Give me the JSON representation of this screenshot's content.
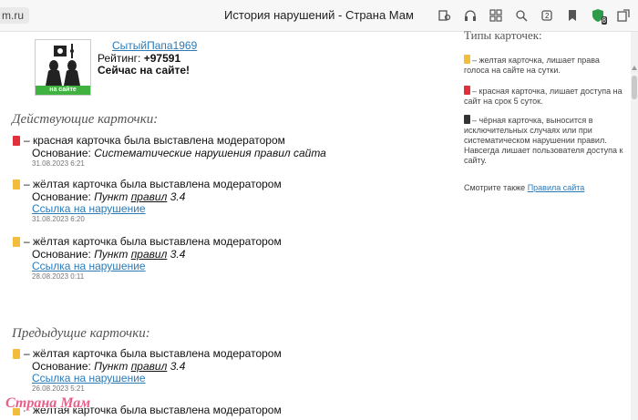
{
  "browser": {
    "url_fragment": "m.ru",
    "window_title": "История нарушений - Страна Мам",
    "icons": [
      "page-search-icon",
      "headphones-icon",
      "collections-icon",
      "zoom-icon",
      "tabs-icon",
      "bookmark-icon",
      "protect-shield-icon",
      "extension-icon"
    ],
    "tabs_count": "2",
    "shield_count": "8"
  },
  "profile": {
    "username": "СытыйПапа1969",
    "rating_label": "Рейтинг:",
    "rating_value": "+97591",
    "status": "Сейчас на сайте!",
    "avatar_label": "на сайте"
  },
  "current": {
    "title": "Действующие карточки:",
    "cards": [
      {
        "color": "red",
        "text": "– красная карточка была выставлена модератором",
        "basis_label": "Основание:",
        "basis": "Систематические нарушения правил сайта",
        "date": "31.08.2023 6:21"
      },
      {
        "color": "yellow",
        "text": "– жёлтая карточка была выставлена модератором",
        "basis_label": "Основание:",
        "basis_pre": "Пункт",
        "basis_link": "правил",
        "basis_post": "3.4",
        "link": "Ссылка на нарушение",
        "date": "31.08.2023 6:20"
      },
      {
        "color": "yellow",
        "text": "– жёлтая карточка была выставлена модератором",
        "basis_label": "Основание:",
        "basis_pre": "Пункт",
        "basis_link": "правил",
        "basis_post": "3.4",
        "link": "Ссылка на нарушение",
        "date": "28.08.2023 0:11"
      }
    ]
  },
  "previous": {
    "title": "Предыдущие карточки:",
    "cards": [
      {
        "color": "yellow",
        "text": "– жёлтая карточка была выставлена модератором",
        "basis_label": "Основание:",
        "basis_pre": "Пункт",
        "basis_link": "правил",
        "basis_post": "3.4",
        "link": "Ссылка на нарушение",
        "date": "26.08.2023 5:21"
      },
      {
        "color": "yellow",
        "text": "– жёлтая карточка была выставлена модератором"
      }
    ]
  },
  "sidebar": {
    "title": "Типы карточек:",
    "yellow": "– желтая карточка, лишает права голоса на сайте на сутки.",
    "red": "– красная карточка, лишает доступа на сайт на срок 5 суток.",
    "black": "– чёрная карточка, выносится в исключительных случаях или при систематическом нарушении правил. Навсегда лишает пользователя доступа к сайту.",
    "see_also": "Смотрите также",
    "rules_link": "Правила сайта"
  },
  "watermark": "Страна Мам",
  "colors": {
    "red": "#e0303a",
    "yellow": "#f2bd3c",
    "black": "#333333",
    "link": "#2a7ab8"
  }
}
